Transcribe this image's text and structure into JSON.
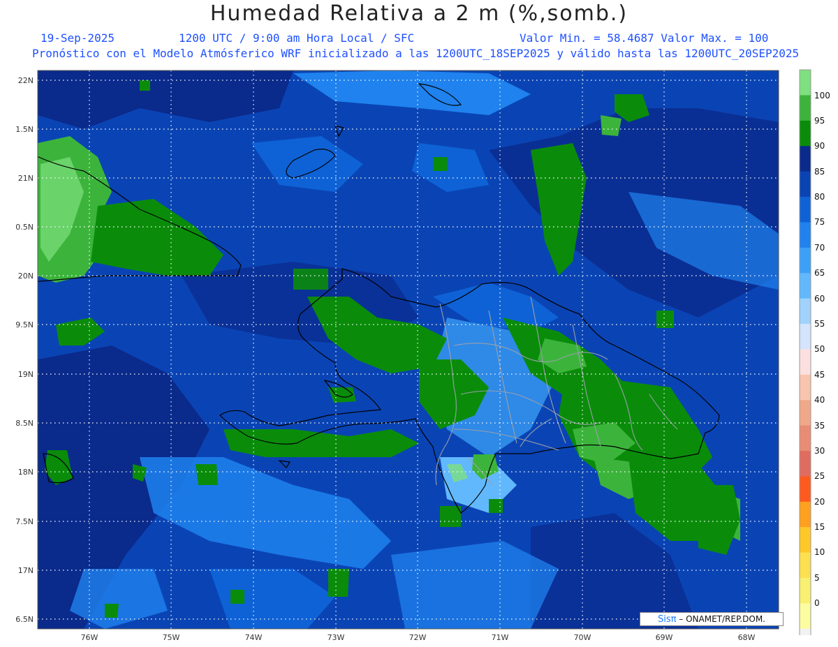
{
  "header": {
    "title": "Humedad Relativa a 2 m (%,somb.)",
    "date": "19-Sep-2025",
    "time": "1200 UTC / 9:00 am Hora Local / SFC",
    "minmax": "Valor Min. = 58.4687  Valor Max. = 100",
    "forecast": "Pronóstico con el Modelo Atmósferico WRF inicializado a las 1200UTC_18SEP2025 y válido hasta las  1200UTC_20SEP2025"
  },
  "lat_labels": [
    "22N",
    "1.5N",
    "21N",
    "0.5N",
    "20N",
    "9.5N",
    "19N",
    "8.5N",
    "18N",
    "7.5N",
    "17N",
    "6.5N"
  ],
  "lon_labels": [
    "76W",
    "75W",
    "74W",
    "73W",
    "72W",
    "71W",
    "70W",
    "69W",
    "68W"
  ],
  "legend": {
    "labels": [
      "100",
      "95",
      "90",
      "85",
      "80",
      "75",
      "70",
      "65",
      "60",
      "55",
      "50",
      "45",
      "40",
      "35",
      "30",
      "25",
      "20",
      "15",
      "10",
      "5",
      "0"
    ],
    "colors": [
      "#7ee07e",
      "#3cb43c",
      "#0a8c0a",
      "#0a2a8c",
      "#0a44b4",
      "#0e62d6",
      "#1f82ee",
      "#3ca0f8",
      "#62b8fc",
      "#a0d2fc",
      "#d4e4fc",
      "#fce0e0",
      "#f8c4ae",
      "#f0a888",
      "#e88c74",
      "#e06c60",
      "#ff5a1e",
      "#ffa01e",
      "#ffc828",
      "#fde050",
      "#f8f070",
      "#fcfca0",
      "#f2f2f2"
    ]
  },
  "credit": {
    "sis": "Sisπ",
    "org": "– ONAMET/REP.DOM."
  }
}
